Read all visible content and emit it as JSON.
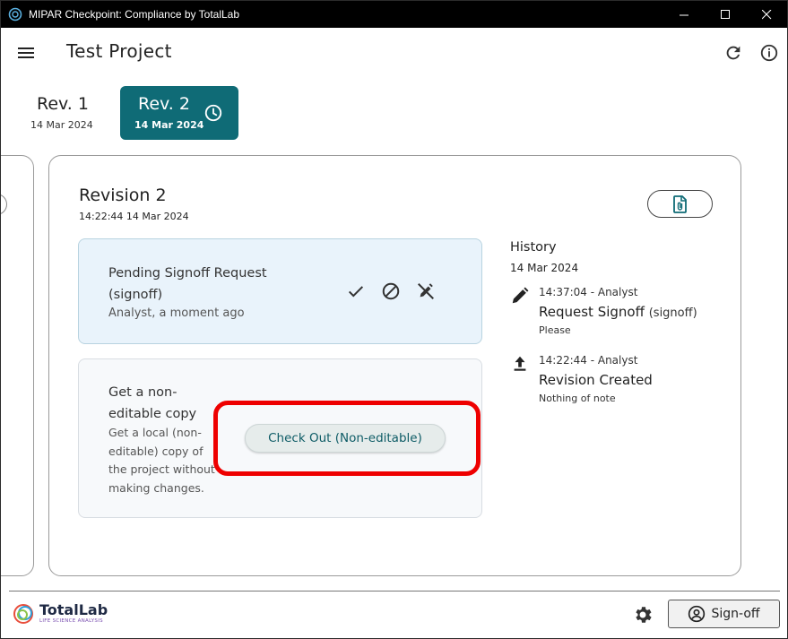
{
  "window": {
    "title": "MIPAR Checkpoint: Compliance by TotalLab"
  },
  "appbar": {
    "project_title": "Test Project"
  },
  "revisions": [
    {
      "label": "Rev. 1",
      "date": "14 Mar 2024"
    },
    {
      "label": "Rev. 2",
      "date": "14 Mar 2024"
    }
  ],
  "card": {
    "title": "Revision 2",
    "timestamp": "14:22:44 14 Mar 2024",
    "pending": {
      "title": "Pending Signoff Request (signoff)",
      "subtitle": "Analyst, a moment ago"
    },
    "checkout": {
      "title": "Get a non-editable copy",
      "description": "Get a local (non-editable) copy of the project without making changes.",
      "button_label": "Check Out (Non-editable)"
    }
  },
  "history": {
    "title": "History",
    "date": "14 Mar 2024",
    "entries": [
      {
        "icon": "pencil-icon",
        "meta": "14:37:04 - Analyst",
        "action": "Request Signoff",
        "tag": "(signoff)",
        "note": "Please"
      },
      {
        "icon": "upload-icon",
        "meta": "14:22:44 - Analyst",
        "action": "Revision Created",
        "tag": "",
        "note": "Nothing of note"
      }
    ]
  },
  "footer": {
    "logo_name": "TotalLab",
    "logo_sub": "LIFE SCIENCE ANALYSIS",
    "signoff_label": "Sign-off"
  },
  "colors": {
    "accent": "#0f6b76",
    "highlight": "#ee0000",
    "pending_bg": "#e9f3fb"
  }
}
